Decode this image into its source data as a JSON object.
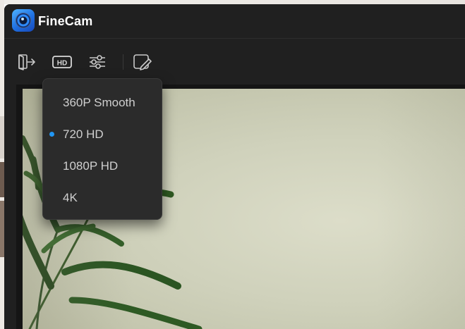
{
  "app": {
    "title": "FineCam"
  },
  "toolbar": {
    "buttons": [
      {
        "icon": "exit-icon"
      },
      {
        "icon": "hd-resolution-icon",
        "label": "HD"
      },
      {
        "icon": "settings-sliders-icon"
      },
      {
        "icon": "edit-overlay-icon"
      }
    ]
  },
  "resolution_menu": {
    "items": [
      {
        "label": "360P Smooth",
        "selected": false
      },
      {
        "label": "720 HD",
        "selected": true
      },
      {
        "label": "1080P HD",
        "selected": false
      },
      {
        "label": "4K",
        "selected": false
      }
    ]
  },
  "colors": {
    "window_bg": "#202020",
    "menu_bg": "#2b2b2b",
    "selected_dot": "#2196f3",
    "menu_text": "#cfcfcf"
  }
}
